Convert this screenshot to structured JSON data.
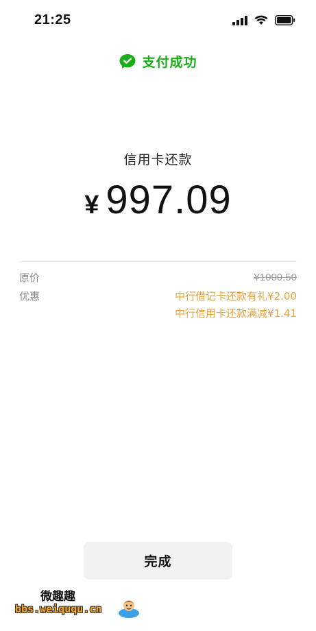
{
  "status_bar": {
    "time": "21:25"
  },
  "header": {
    "success_text": "支付成功",
    "icon": "wechat-pay-icon",
    "accent_color": "#1aad19"
  },
  "payment": {
    "payee": "信用卡还款",
    "currency_symbol": "¥",
    "amount": "997.09"
  },
  "details": {
    "original_price_label": "原价",
    "original_price_value": "¥1000.50",
    "discount_label": "优惠",
    "discounts": [
      "中行借记卡还款有礼¥2.00",
      "中行信用卡还款满减¥1.41"
    ],
    "discount_color": "#e6a23c"
  },
  "actions": {
    "done_label": "完成"
  },
  "watermark": {
    "title": "微趣趣",
    "url": "bbs.weiququ.cn"
  }
}
